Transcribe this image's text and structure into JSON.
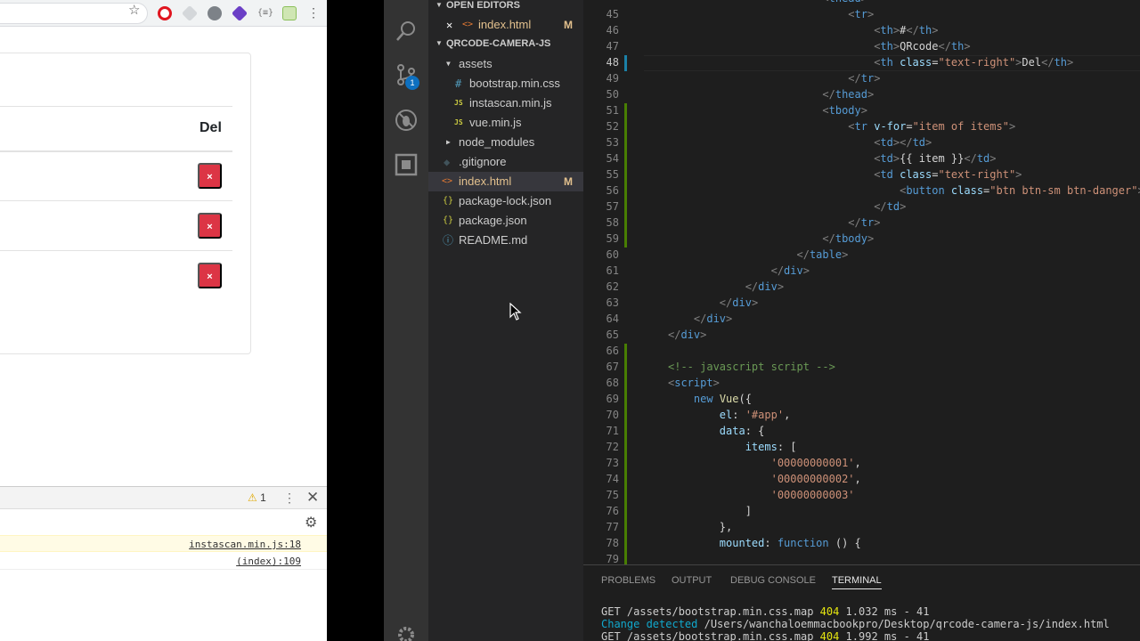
{
  "browser": {
    "extensions": [
      "opera-icon",
      "cube-extension-icon",
      "film-extension-icon",
      "purple-extension-icon",
      "json-extension-icon",
      "sheet-extension-icon"
    ],
    "table": {
      "header_del": "Del",
      "row_button_label": "×"
    },
    "devtools": {
      "warning_count": "1",
      "console": [
        {
          "source": "instascan.min.js:18",
          "type": "warn"
        },
        {
          "source": "(index):109",
          "type": "info"
        }
      ]
    }
  },
  "vscode": {
    "sidebar": {
      "open_editors_title": "OPEN EDITORS",
      "open_editor": {
        "label": "index.html",
        "status": "M"
      },
      "project_title": "QRCODE-CAMERA-JS",
      "items": [
        {
          "label": "assets",
          "type": "folder-open"
        },
        {
          "label": "bootstrap.min.css",
          "type": "css"
        },
        {
          "label": "instascan.min.js",
          "type": "js"
        },
        {
          "label": "vue.min.js",
          "type": "js"
        },
        {
          "label": "node_modules",
          "type": "folder"
        },
        {
          "label": ".gitignore",
          "type": "git"
        },
        {
          "label": "index.html",
          "type": "html",
          "status": "M"
        },
        {
          "label": "package-lock.json",
          "type": "json"
        },
        {
          "label": "package.json",
          "type": "json"
        },
        {
          "label": "README.md",
          "type": "info"
        }
      ]
    },
    "activity_badge": "1",
    "editor": {
      "line_numbers": [
        "45",
        "46",
        "47",
        "48",
        "49",
        "50",
        "51",
        "52",
        "53",
        "54",
        "55",
        "56",
        "57",
        "58",
        "59",
        "60",
        "61",
        "62",
        "63",
        "64",
        "65",
        "66",
        "67",
        "68",
        "69",
        "70",
        "71",
        "72",
        "73",
        "74",
        "75",
        "76",
        "77",
        "78",
        "79"
      ],
      "current_line": "48"
    },
    "panel": {
      "tabs": [
        "PROBLEMS",
        "OUTPUT",
        "DEBUG CONSOLE",
        "TERMINAL"
      ],
      "active_tab": "TERMINAL",
      "lines": [
        {
          "pre": "GET /assets/bootstrap.min.css.map ",
          "status": "404",
          "post": " 1.032 ms - 41"
        },
        {
          "pre": "Change detected ",
          "path": "/Users/wanchaloemmacbookpro/Desktop/qrcode-camera-js/index.html"
        },
        {
          "pre": "GET /assets/bootstrap.min.css.map ",
          "status": "404",
          "post": " 1.992 ms - 41"
        }
      ]
    }
  }
}
